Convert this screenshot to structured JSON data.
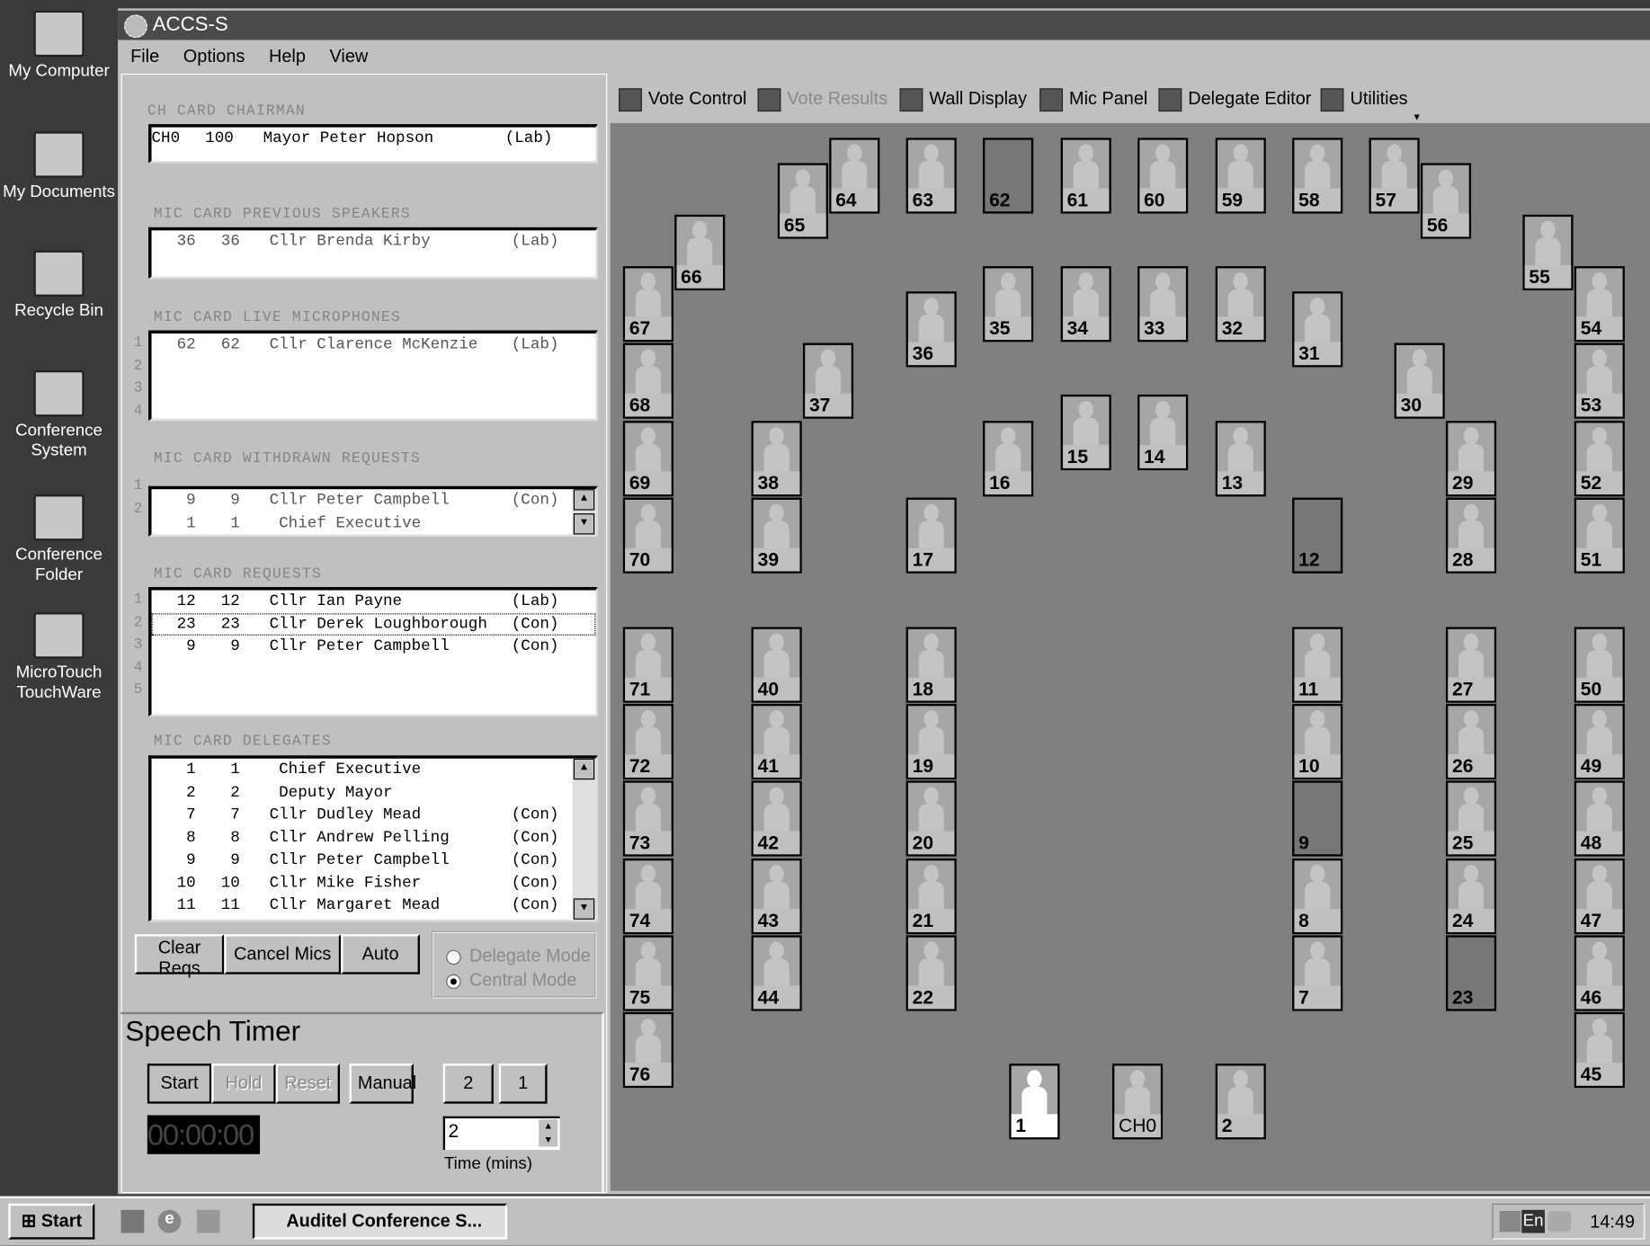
{
  "desktop": {
    "icons": [
      {
        "label": "My Computer"
      },
      {
        "label": "My Documents"
      },
      {
        "label": "Recycle Bin"
      },
      {
        "label": "Conference System"
      },
      {
        "label": "Conference Folder"
      },
      {
        "label": "MicroTouch TouchWare"
      }
    ]
  },
  "window": {
    "title": "ACCS-S",
    "menu": [
      "File",
      "Options",
      "Help",
      "View"
    ]
  },
  "toolbar": {
    "items": [
      {
        "label": "Vote Control",
        "enabled": true
      },
      {
        "label": "Vote Results",
        "enabled": false
      },
      {
        "label": "Wall Display",
        "enabled": true
      },
      {
        "label": "Mic Panel",
        "enabled": true
      },
      {
        "label": "Delegate Editor",
        "enabled": true
      },
      {
        "label": "Utilities",
        "enabled": true
      }
    ]
  },
  "panels": {
    "chairman": {
      "header": "CH   CARD CHAIRMAN",
      "rows": [
        {
          "mic": "CH0",
          "card": "100",
          "name": "Mayor Peter Hopson",
          "party": "(Lab)"
        }
      ]
    },
    "previous": {
      "header": "MIC CARD PREVIOUS SPEAKERS",
      "rows": [
        {
          "mic": "36",
          "card": "36",
          "name": "Cllr Brenda Kirby",
          "party": "(Lab)"
        }
      ]
    },
    "live": {
      "header": "MIC CARD LIVE MICROPHONES",
      "line_numbers": [
        "1",
        "2",
        "3",
        "4"
      ],
      "rows": [
        {
          "mic": "62",
          "card": "62",
          "name": "Cllr Clarence McKenzie",
          "party": "(Lab)"
        }
      ]
    },
    "withdrawn": {
      "header": "MIC CARD WITHDRAWN REQUESTS",
      "line_numbers": [
        "1",
        "2"
      ],
      "rows": [
        {
          "mic": "9",
          "card": "9",
          "name": "Cllr Peter Campbell",
          "party": "(Con)"
        },
        {
          "mic": "1",
          "card": "1",
          "name": " Chief Executive",
          "party": ""
        }
      ]
    },
    "requests": {
      "header": "MIC CARD REQUESTS",
      "line_numbers": [
        "1",
        "2",
        "3",
        "4",
        "5"
      ],
      "rows": [
        {
          "mic": "12",
          "card": "12",
          "name": "Cllr Ian Payne",
          "party": "(Lab)"
        },
        {
          "mic": "23",
          "card": "23",
          "name": "Cllr Derek Loughborough",
          "party": "(Con)"
        },
        {
          "mic": "9",
          "card": "9",
          "name": "Cllr Peter Campbell",
          "party": "(Con)"
        }
      ]
    },
    "delegates": {
      "header": "MIC CARD DELEGATES",
      "rows": [
        {
          "mic": "1",
          "card": "1",
          "name": " Chief Executive",
          "party": ""
        },
        {
          "mic": "2",
          "card": "2",
          "name": " Deputy Mayor",
          "party": ""
        },
        {
          "mic": "7",
          "card": "7",
          "name": "Cllr Dudley Mead",
          "party": "(Con)"
        },
        {
          "mic": "8",
          "card": "8",
          "name": "Cllr Andrew Pelling",
          "party": "(Con)"
        },
        {
          "mic": "9",
          "card": "9",
          "name": "Cllr Peter Campbell",
          "party": "(Con)"
        },
        {
          "mic": "10",
          "card": "10",
          "name": "Cllr Mike Fisher",
          "party": "(Con)"
        },
        {
          "mic": "11",
          "card": "11",
          "name": "Cllr Margaret Mead",
          "party": "(Con)"
        }
      ]
    }
  },
  "controls": {
    "clear_reqs": "Clear Reqs",
    "cancel_mics": "Cancel Mics",
    "auto": "Auto",
    "delegate_mode": "Delegate Mode",
    "central_mode": "Central Mode",
    "selected_mode": "central"
  },
  "speech_timer": {
    "title": "Speech Timer",
    "start": "Start",
    "hold": "Hold",
    "reset": "Reset",
    "manual": "Manual",
    "preset_a": "2",
    "preset_b": "1",
    "display": "00:00:00",
    "time_value": "2",
    "time_label": "Time (mins)"
  },
  "seats": [
    {
      "id": "64",
      "state": "idle"
    },
    {
      "id": "63",
      "state": "idle"
    },
    {
      "id": "62",
      "state": "empty"
    },
    {
      "id": "61",
      "state": "idle"
    },
    {
      "id": "60",
      "state": "idle"
    },
    {
      "id": "59",
      "state": "idle"
    },
    {
      "id": "58",
      "state": "idle"
    },
    {
      "id": "57",
      "state": "idle"
    },
    {
      "id": "65",
      "state": "idle"
    },
    {
      "id": "56",
      "state": "idle"
    },
    {
      "id": "66",
      "state": "idle"
    },
    {
      "id": "55",
      "state": "idle"
    },
    {
      "id": "67",
      "state": "idle"
    },
    {
      "id": "35",
      "state": "idle"
    },
    {
      "id": "34",
      "state": "idle"
    },
    {
      "id": "33",
      "state": "idle"
    },
    {
      "id": "32",
      "state": "idle"
    },
    {
      "id": "54",
      "state": "idle"
    },
    {
      "id": "36",
      "state": "idle"
    },
    {
      "id": "31",
      "state": "idle"
    },
    {
      "id": "68",
      "state": "idle"
    },
    {
      "id": "37",
      "state": "idle"
    },
    {
      "id": "30",
      "state": "idle"
    },
    {
      "id": "53",
      "state": "idle"
    },
    {
      "id": "15",
      "state": "idle"
    },
    {
      "id": "14",
      "state": "idle"
    },
    {
      "id": "69",
      "state": "idle"
    },
    {
      "id": "38",
      "state": "idle"
    },
    {
      "id": "16",
      "state": "idle"
    },
    {
      "id": "13",
      "state": "idle"
    },
    {
      "id": "29",
      "state": "idle"
    },
    {
      "id": "52",
      "state": "idle"
    },
    {
      "id": "70",
      "state": "idle"
    },
    {
      "id": "39",
      "state": "idle"
    },
    {
      "id": "17",
      "state": "idle"
    },
    {
      "id": "12",
      "state": "empty"
    },
    {
      "id": "28",
      "state": "idle"
    },
    {
      "id": "51",
      "state": "idle"
    },
    {
      "id": "71",
      "state": "idle"
    },
    {
      "id": "72",
      "state": "idle"
    },
    {
      "id": "73",
      "state": "idle"
    },
    {
      "id": "74",
      "state": "idle"
    },
    {
      "id": "75",
      "state": "idle"
    },
    {
      "id": "76",
      "state": "idle"
    },
    {
      "id": "40",
      "state": "idle"
    },
    {
      "id": "41",
      "state": "idle"
    },
    {
      "id": "42",
      "state": "idle"
    },
    {
      "id": "43",
      "state": "idle"
    },
    {
      "id": "44",
      "state": "idle"
    },
    {
      "id": "18",
      "state": "idle"
    },
    {
      "id": "19",
      "state": "idle"
    },
    {
      "id": "20",
      "state": "idle"
    },
    {
      "id": "21",
      "state": "idle"
    },
    {
      "id": "22",
      "state": "idle"
    },
    {
      "id": "11",
      "state": "idle"
    },
    {
      "id": "10",
      "state": "idle"
    },
    {
      "id": "9",
      "state": "empty"
    },
    {
      "id": "8",
      "state": "idle"
    },
    {
      "id": "7",
      "state": "idle"
    },
    {
      "id": "27",
      "state": "idle"
    },
    {
      "id": "26",
      "state": "idle"
    },
    {
      "id": "25",
      "state": "idle"
    },
    {
      "id": "24",
      "state": "idle"
    },
    {
      "id": "23",
      "state": "empty"
    },
    {
      "id": "50",
      "state": "idle"
    },
    {
      "id": "49",
      "state": "idle"
    },
    {
      "id": "48",
      "state": "idle"
    },
    {
      "id": "47",
      "state": "idle"
    },
    {
      "id": "46",
      "state": "idle"
    },
    {
      "id": "45",
      "state": "idle"
    },
    {
      "id": "1",
      "state": "active"
    },
    {
      "id": "CH0",
      "state": "idle"
    },
    {
      "id": "2",
      "state": "idle"
    }
  ],
  "taskbar": {
    "start": "Start",
    "task": "Auditel Conference S...",
    "lang": "En",
    "clock": "14:49"
  }
}
